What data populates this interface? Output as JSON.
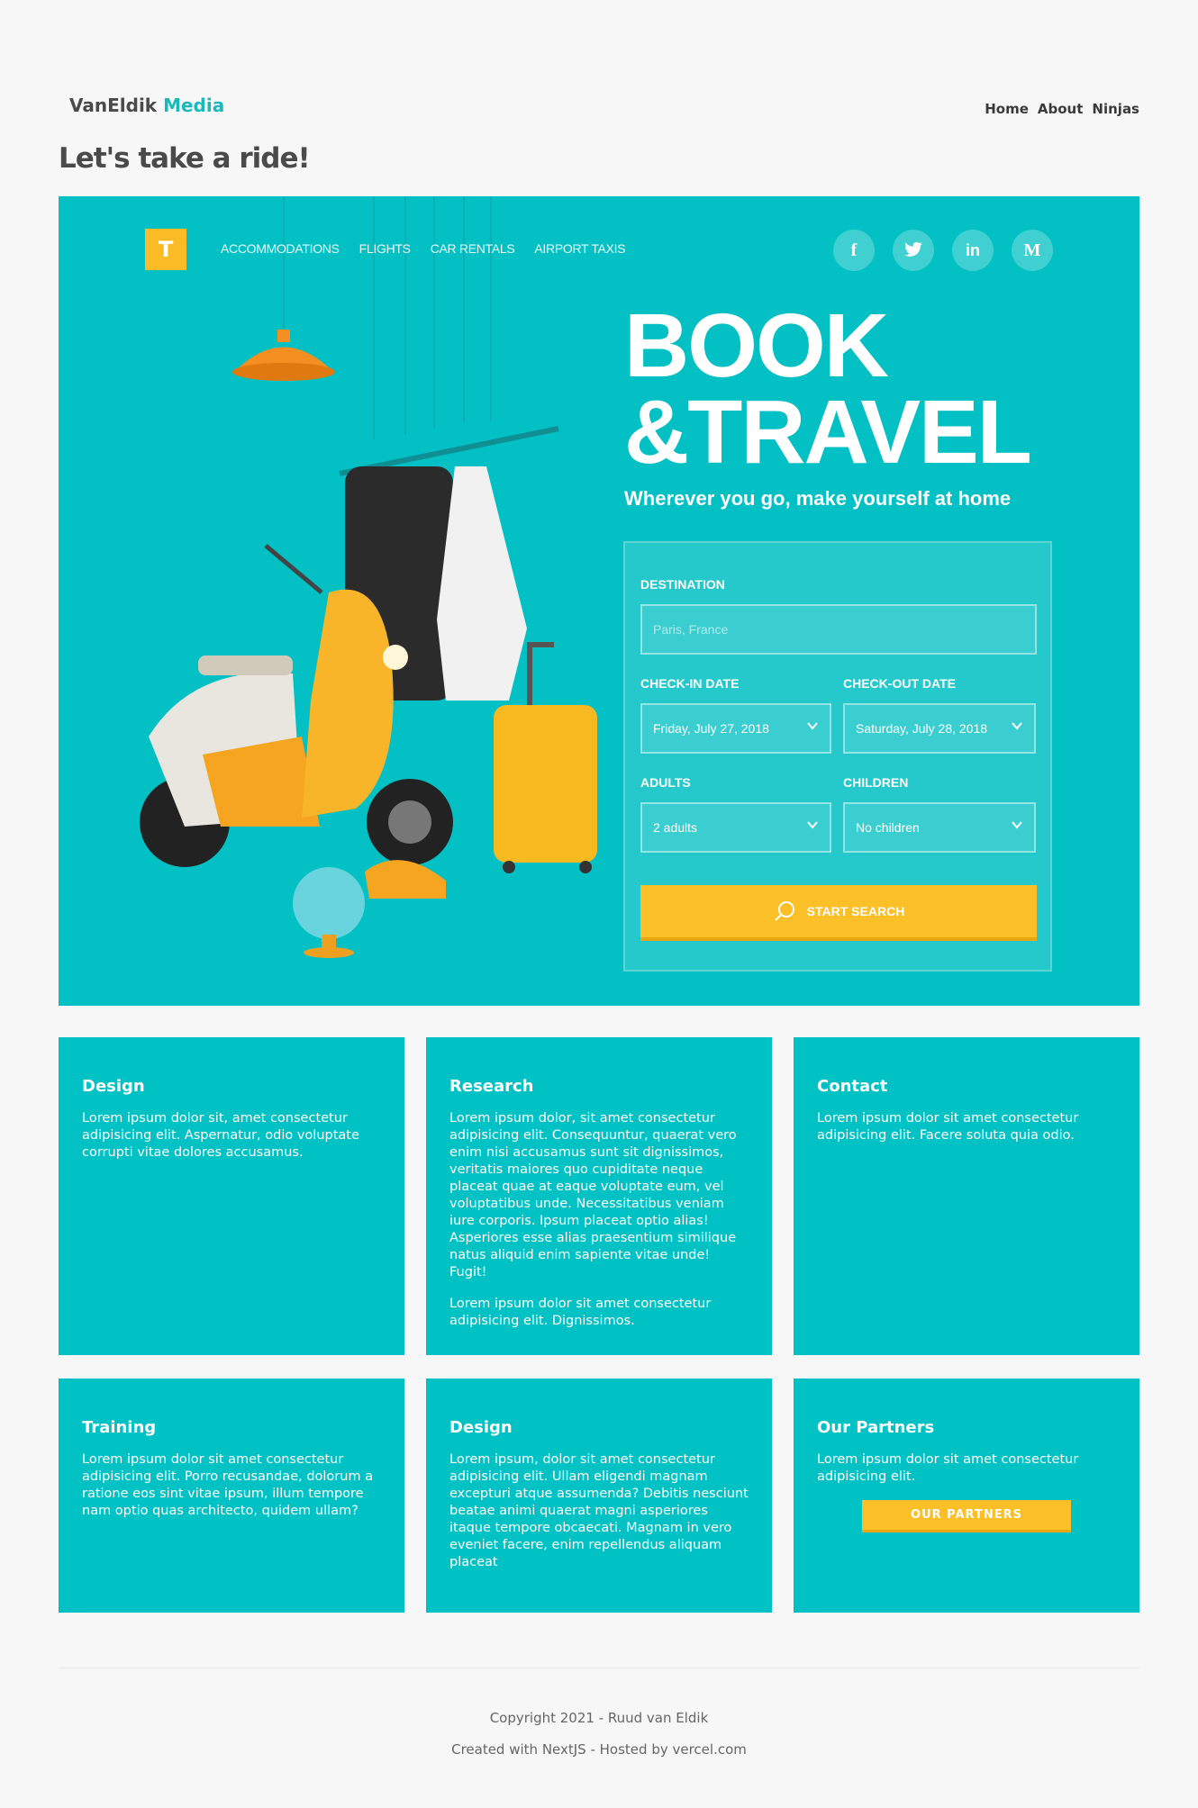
{
  "brand": {
    "name_part1": "VanEldik",
    "name_part2": "Media"
  },
  "nav": {
    "items": [
      "Home",
      "About",
      "Ninjas"
    ]
  },
  "page_title": "Let's take a ride!",
  "hero": {
    "logo_letter": "T",
    "nav_items": [
      "ACCOMMODATIONS",
      "FLIGHTS",
      "CAR RENTALS",
      "AIRPORT TAXIS"
    ],
    "socials": [
      {
        "icon": "facebook-icon",
        "glyph": "f"
      },
      {
        "icon": "twitter-icon",
        "glyph": "🐦"
      },
      {
        "icon": "linkedin-icon",
        "glyph": "in"
      },
      {
        "icon": "medium-icon",
        "glyph": "M"
      }
    ],
    "headline_line1": "BOOK",
    "headline_line2": "&TRAVEL",
    "tagline": "Wherever you go, make yourself at home",
    "form": {
      "destination_label": "DESTINATION",
      "destination_placeholder": "Paris, France",
      "checkin_label": "CHECK-IN DATE",
      "checkin_value": "Friday, July 27, 2018",
      "checkout_label": "CHECK-OUT DATE",
      "checkout_value": "Saturday, July 28, 2018",
      "adults_label": "ADULTS",
      "adults_value": "2 adults",
      "children_label": "CHILDREN",
      "children_value": "No children",
      "search_button": "START SEARCH"
    },
    "colors": {
      "background": "#02c0c3",
      "accent": "#fbbf27"
    }
  },
  "cards": [
    {
      "title": "Design",
      "paragraphs": [
        "Lorem ipsum dolor sit, amet consectetur adipisicing elit. Aspernatur, odio voluptate corrupti vitae dolores accusamus."
      ]
    },
    {
      "title": "Research",
      "paragraphs": [
        "Lorem ipsum dolor, sit amet consectetur adipisicing elit. Consequuntur, quaerat vero enim nisi accusamus sunt sit dignissimos, veritatis maiores quo cupiditate neque placeat quae at eaque voluptate eum, vel voluptatibus unde. Necessitatibus veniam iure corporis. Ipsum placeat optio alias! Asperiores esse alias praesentium similique natus aliquid enim sapiente vitae unde! Fugit!",
        "Lorem ipsum dolor sit amet consectetur adipisicing elit. Dignissimos."
      ]
    },
    {
      "title": "Contact",
      "paragraphs": [
        "Lorem ipsum dolor sit amet consectetur adipisicing elit. Facere soluta quia odio."
      ]
    },
    {
      "title": "Training",
      "paragraphs": [
        "Lorem ipsum dolor sit amet consectetur adipisicing elit. Porro recusandae, dolorum a ratione eos sint vitae ipsum, illum tempore nam optio quas architecto, quidem ullam?"
      ]
    },
    {
      "title": "Design",
      "paragraphs": [
        "Lorem ipsum, dolor sit amet consectetur adipisicing elit. Ullam eligendi magnam excepturi atque assumenda? Debitis nesciunt beatae animi quaerat magni asperiores itaque tempore obcaecati. Magnam in vero eveniet facere, enim repellendus aliquam placeat"
      ]
    },
    {
      "title": "Our Partners",
      "paragraphs": [
        "Lorem ipsum dolor sit amet consectetur adipisicing elit."
      ],
      "button": "OUR PARTNERS"
    }
  ],
  "footer": {
    "copyright": "Copyright 2021 - Ruud van Eldik",
    "credits": "Created with NextJS - Hosted by vercel.com"
  }
}
